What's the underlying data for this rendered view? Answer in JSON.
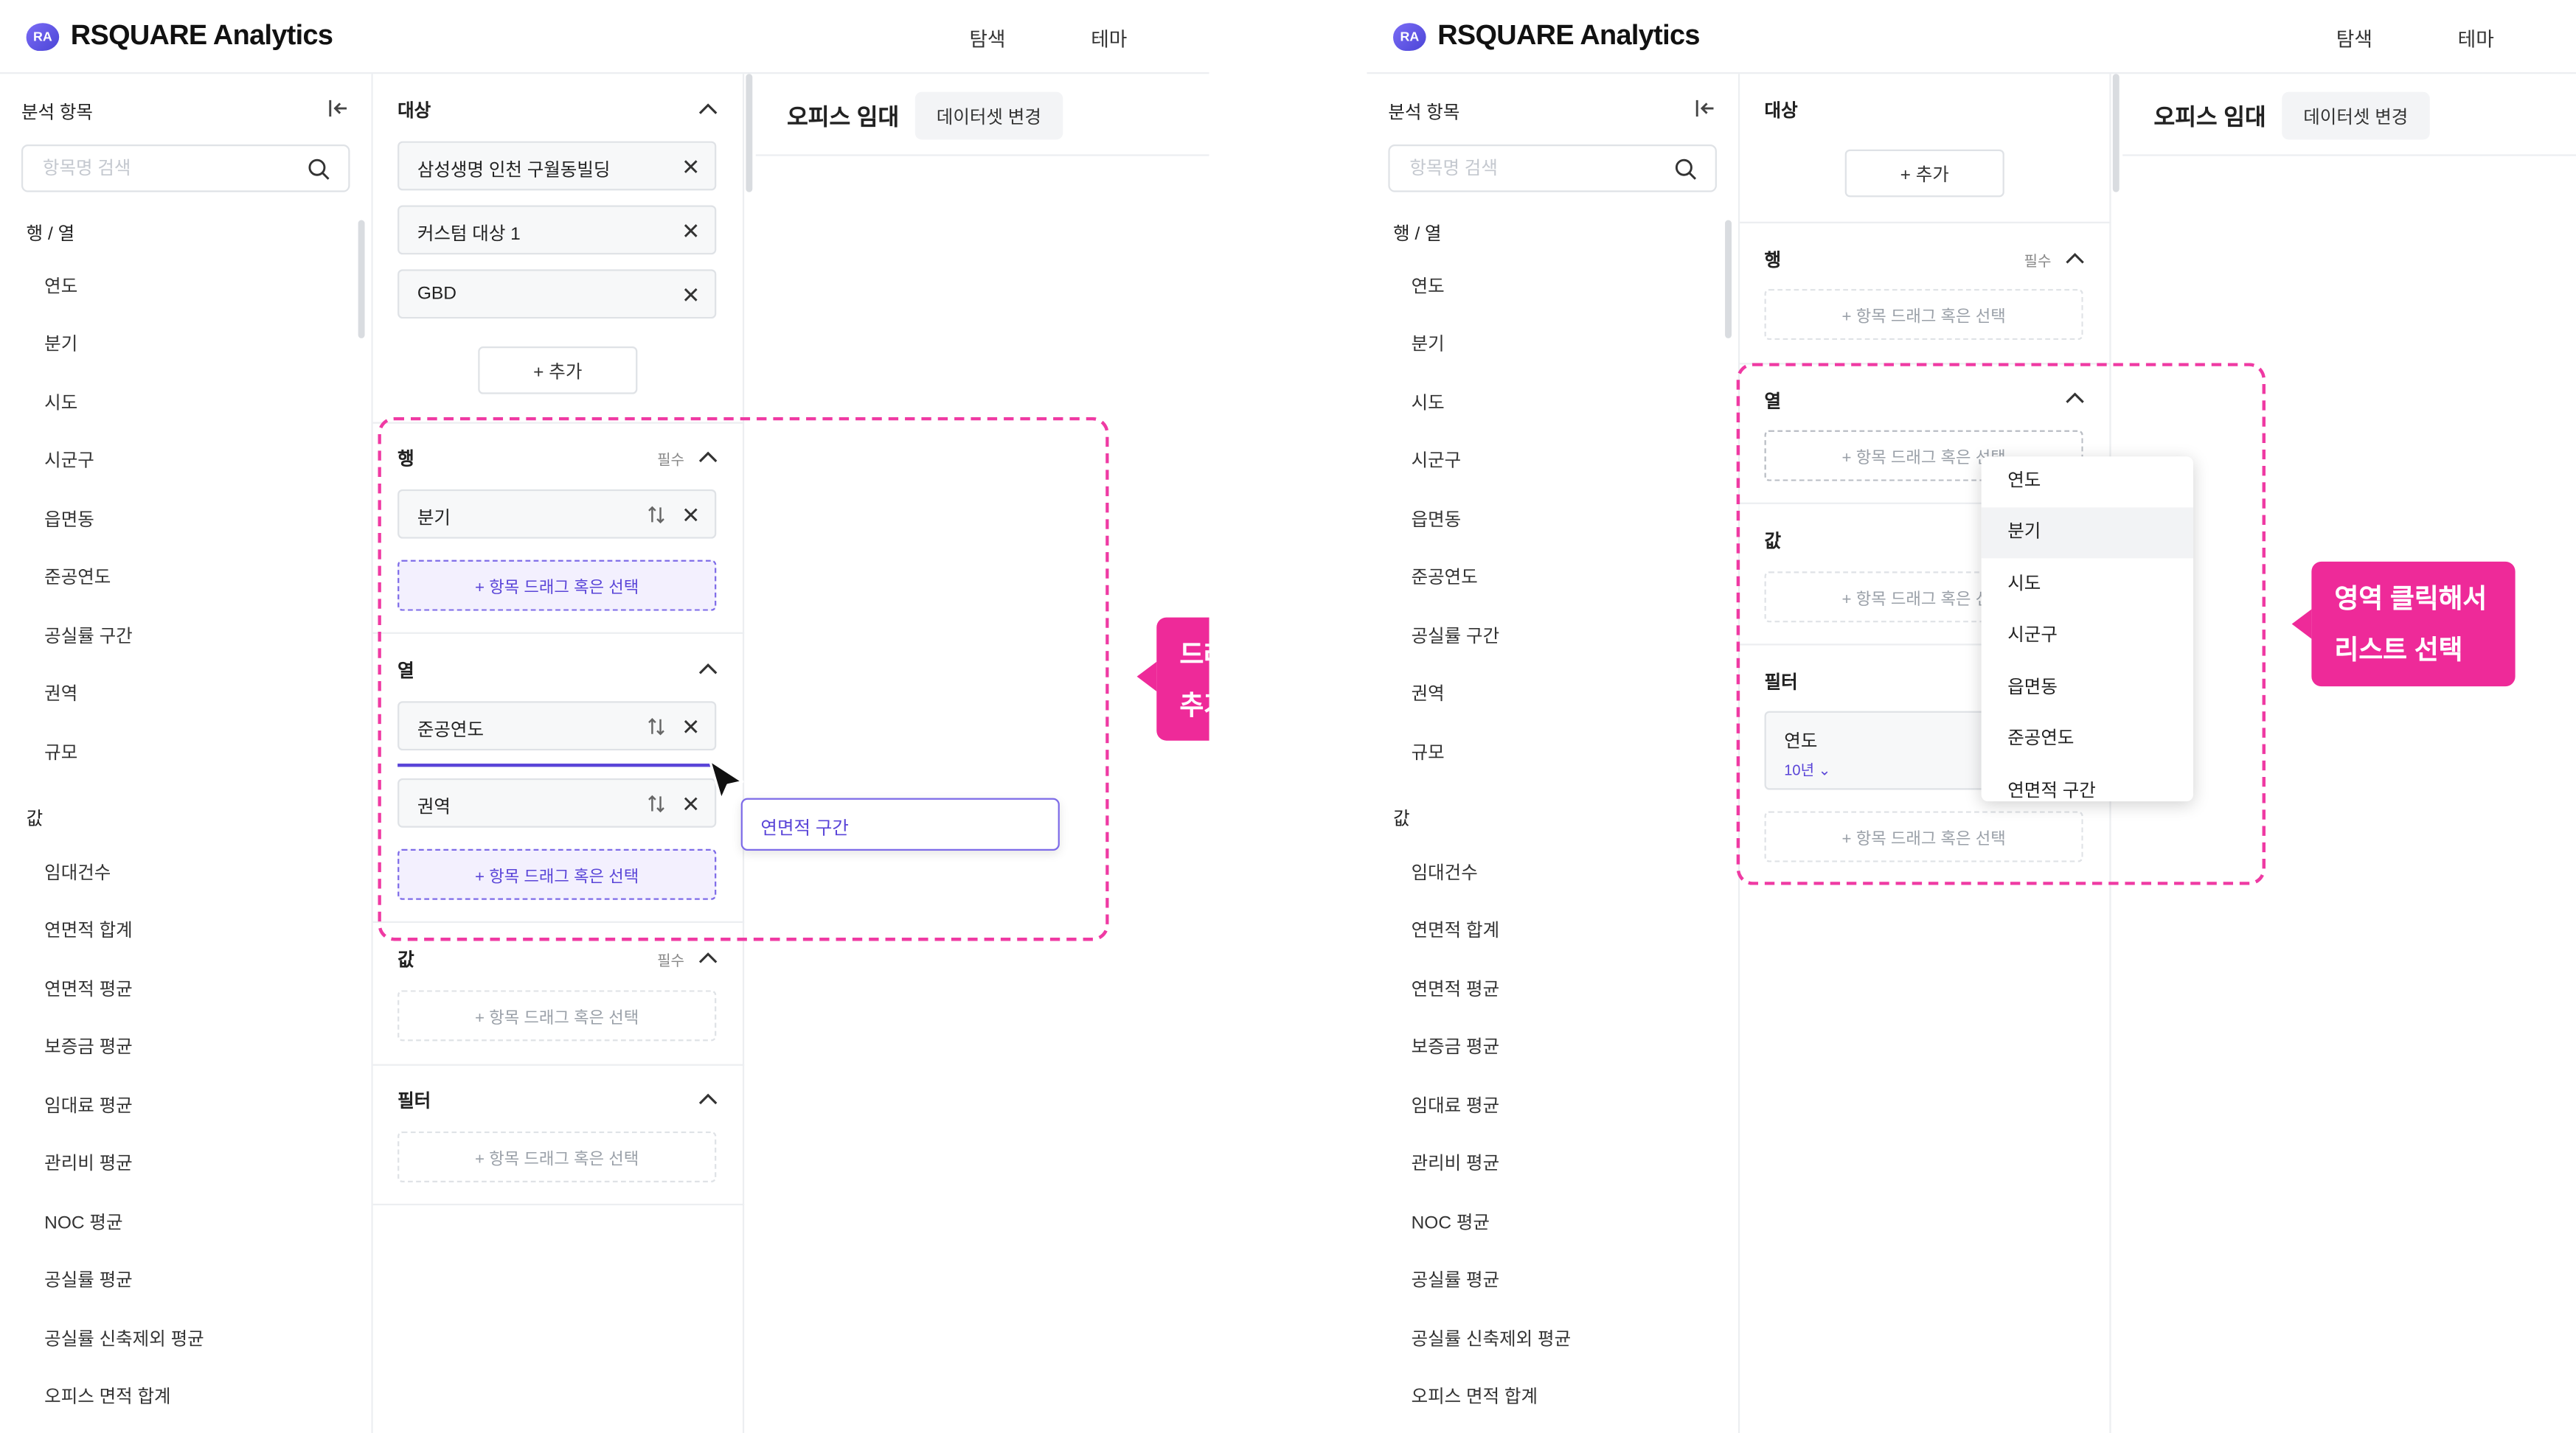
{
  "app": {
    "logo_mark": "RA",
    "logo_text": "RSQUARE Analytics",
    "nav": [
      "탐색",
      "테마"
    ]
  },
  "sidebar": {
    "title": "분석 항목",
    "search_placeholder": "항목명 검색",
    "group_rowcol": "행 / 열",
    "rowcol_items": [
      "연도",
      "분기",
      "시도",
      "시군구",
      "읍면동",
      "준공연도",
      "공실률 구간",
      "권역",
      "규모"
    ],
    "group_values": "값",
    "value_items": [
      "임대건수",
      "연면적 합계",
      "연면적 평균",
      "보증금 평균",
      "임대료 평균",
      "관리비 평균",
      "NOC 평균",
      "공실률 평균",
      "공실률 신축제외 평균",
      "오피스 면적 합계"
    ]
  },
  "config": {
    "target_title": "대상",
    "targets": [
      "삼성생명 인천 구월동빌딩",
      "커스텀 대상 1",
      "GBD"
    ],
    "add_label": "+ 추가",
    "row_title": "행",
    "required": "필수",
    "row_items": [
      "분기"
    ],
    "drop_placeholder": "+ 항목 드래그 혹은 선택",
    "col_title": "열",
    "col_items": [
      "준공연도",
      "권역"
    ],
    "value_title": "값",
    "filter_title": "필터",
    "filter_item": "연도",
    "filter_sub": "10년"
  },
  "main": {
    "title": "오피스 임대",
    "dataset_button": "데이터셋 변경"
  },
  "drag": {
    "ghost_label": "연면적 구간"
  },
  "dropdown": {
    "items": [
      "연도",
      "분기",
      "시도",
      "시군구",
      "읍면동",
      "준공연도",
      "연면적 구간"
    ],
    "highlighted_index": 1
  },
  "annotations": {
    "left_line1": "드래그해서",
    "left_line2": "추가하기",
    "right_line1": "영역 클릭해서",
    "right_line2": "리스트 선택"
  },
  "colors": {
    "accent": "#5a45d8",
    "annotation_pink": "#ee2a99"
  }
}
